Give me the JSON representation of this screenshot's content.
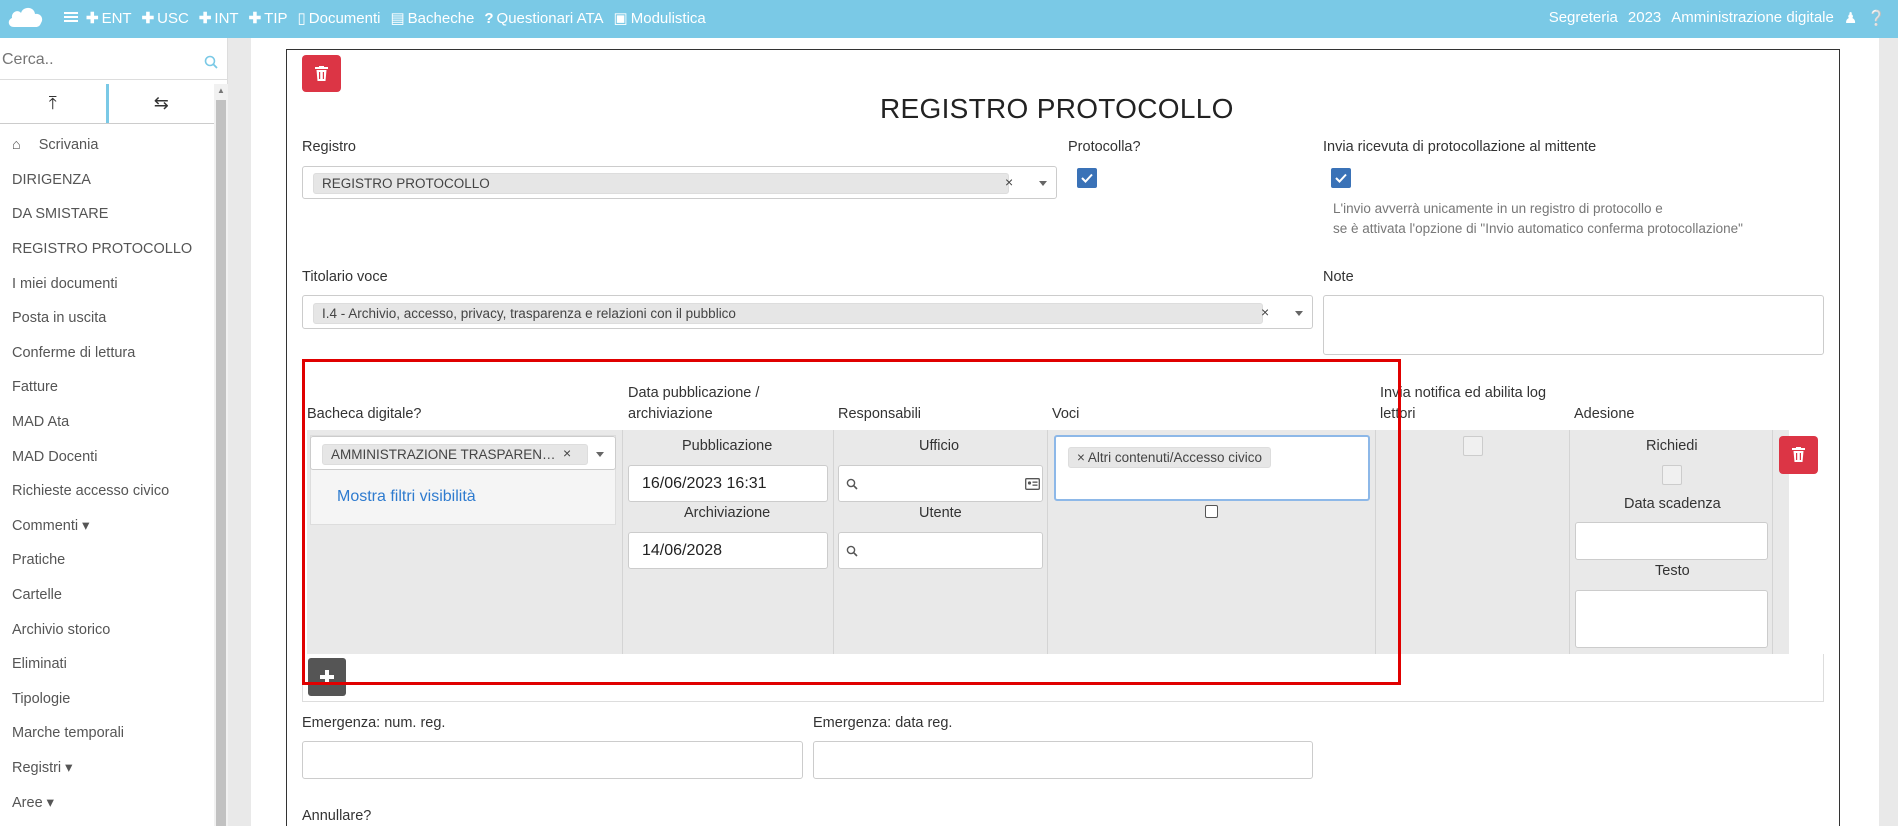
{
  "topbar": {
    "nav": [
      {
        "icon": "plus-icon",
        "label": "ENT"
      },
      {
        "icon": "plus-icon",
        "label": "USC"
      },
      {
        "icon": "plus-icon",
        "label": "INT"
      },
      {
        "icon": "plus-icon",
        "label": "TIP"
      },
      {
        "icon": "document-icon",
        "label": "Documenti"
      },
      {
        "icon": "board-icon",
        "label": "Bacheche"
      },
      {
        "icon": "question-icon",
        "label": "Questionari ATA"
      },
      {
        "icon": "form-icon",
        "label": "Modulistica"
      }
    ],
    "right": {
      "office": "Segreteria",
      "year": "2023",
      "admin": "Amministrazione digitale"
    }
  },
  "sidebar": {
    "search_placeholder": "Cerca..",
    "items": [
      "Scrivania",
      "DIRIGENZA",
      "DA SMISTARE",
      "REGISTRO PROTOCOLLO",
      "I miei documenti",
      "Posta in uscita",
      "Conferme di lettura",
      "Fatture",
      "MAD Ata",
      "MAD Docenti",
      "Richieste accesso civico",
      "Commenti ▾",
      "Pratiche",
      "Cartelle",
      "Archivio storico",
      "Eliminati",
      "Tipologie",
      "Marche temporali",
      "Registri ▾",
      "Aree ▾"
    ]
  },
  "form": {
    "title": "REGISTRO PROTOCOLLO",
    "registro_label": "Registro",
    "registro_value": "REGISTRO PROTOCOLLO",
    "protocolla_label": "Protocolla?",
    "ricevuta_label": "Invia ricevuta di protocollazione al mittente",
    "ricevuta_hint_1": "L'invio avverrà unicamente in un registro di protocollo e",
    "ricevuta_hint_2": "se è attivata l'opzione di \"Invio automatico conferma protocollazione\"",
    "titolario_label": "Titolario voce",
    "titolario_value": "I.4 - Archivio, accesso, privacy, trasparenza e relazioni con il pubblico",
    "note_label": "Note",
    "emergenza_num_label": "Emergenza: num. reg.",
    "emergenza_data_label": "Emergenza: data reg.",
    "annullare_label": "Annullare?"
  },
  "table": {
    "headers": {
      "bacheca": "Bacheca digitale?",
      "data_1": "Data pubblicazione /",
      "data_2": "archiviazione",
      "responsabili": "Responsabili",
      "voci": "Voci",
      "notifica_1": "Invia notifica ed abilita log",
      "notifica_2": "lettori",
      "adesione": "Adesione"
    },
    "row": {
      "bacheca_value": "AMMINISTRAZIONE TRASPAREN…",
      "filtri_link": "Mostra filtri visibilità",
      "pubblicazione_label": "Pubblicazione",
      "pubblicazione_value": "16/06/2023 16:31",
      "archiviazione_label": "Archiviazione",
      "archiviazione_value": "14/06/2028",
      "ufficio_label": "Ufficio",
      "utente_label": "Utente",
      "voci_tag": "Altri contenuti/Accesso civico",
      "richiedi_label": "Richiedi",
      "data_scadenza_label": "Data scadenza",
      "testo_label": "Testo"
    }
  },
  "colors": {
    "topbar": "#7ac9e6",
    "danger": "#dc3545",
    "check": "#3a72b7",
    "highlight": "#e00000"
  }
}
